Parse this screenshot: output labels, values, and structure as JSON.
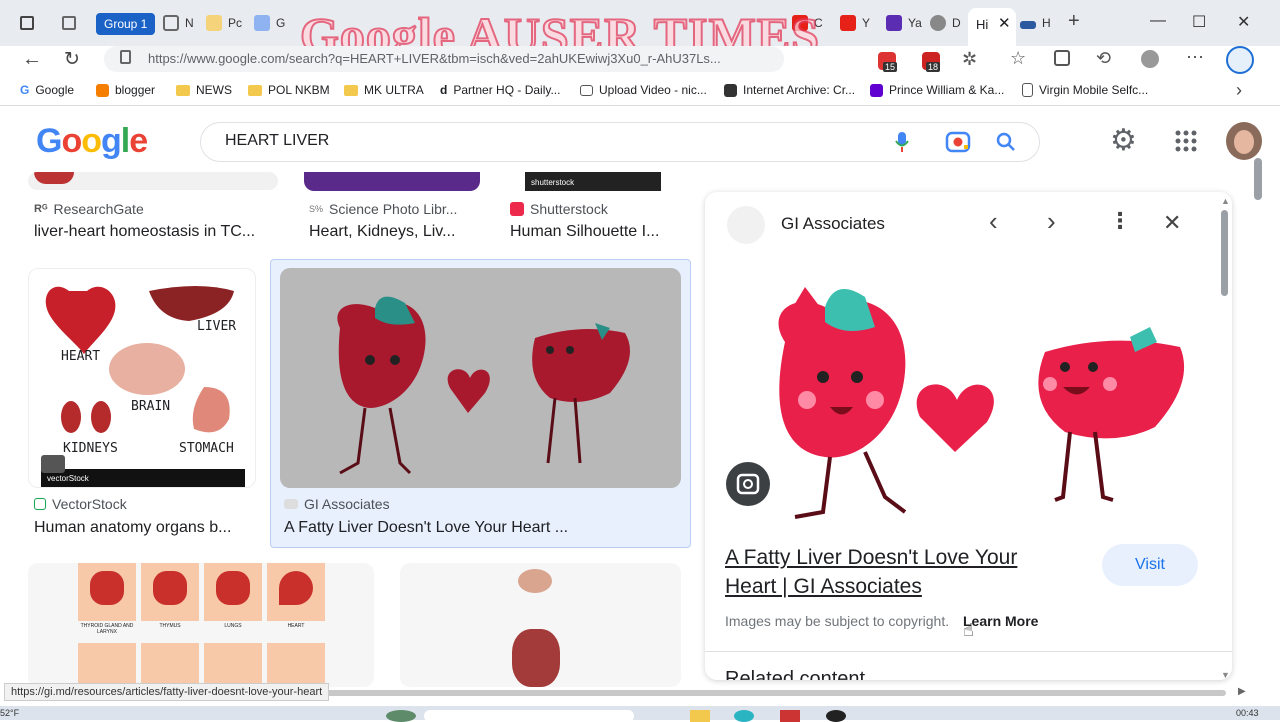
{
  "browser": {
    "group_label": "Group 1",
    "watermark": "Google AUSER TIMES",
    "url": "https://www.google.com/search?q=HEART+LIVER&tbm=isch&ved=2ahUKEwiwj3Xu0_r-AhU37Ls...",
    "tab_badges": [
      "15",
      "18"
    ],
    "bookmarks": [
      {
        "label": "Google",
        "icon": "google-icon"
      },
      {
        "label": "blogger",
        "icon": "blogger-icon"
      },
      {
        "label": "NEWS",
        "icon": "folder-icon"
      },
      {
        "label": "POL NKBM",
        "icon": "folder-icon"
      },
      {
        "label": "MK ULTRA",
        "icon": "folder-icon"
      },
      {
        "label": "Partner HQ - Daily...",
        "icon": "dailymotion-icon"
      },
      {
        "label": "Upload Video - nic...",
        "icon": "upload-icon"
      },
      {
        "label": "Internet Archive: Cr...",
        "icon": "archive-icon"
      },
      {
        "label": "Prince William & Ka...",
        "icon": "yahoo-icon"
      },
      {
        "label": "Virgin Mobile Selfc...",
        "icon": "page-icon"
      }
    ]
  },
  "google": {
    "logo": "Google",
    "query": "HEART LIVER"
  },
  "results": {
    "row1": [
      {
        "source": "ResearchGate",
        "title": "liver-heart homeostasis in TC..."
      },
      {
        "source": "Science Photo Libr...",
        "title": "Heart, Kidneys, Liv..."
      },
      {
        "source": "Shutterstock",
        "title": "Human Silhouette I..."
      }
    ],
    "row2": [
      {
        "source": "VectorStock",
        "title": "Human anatomy organs b...",
        "labels": [
          "HEART",
          "LIVER",
          "BRAIN",
          "KIDNEYS",
          "STOMACH"
        ]
      },
      {
        "source": "GI Associates",
        "title": "A Fatty Liver Doesn't Love Your Heart ..."
      }
    ],
    "row3_labels": [
      "THYROID GLAND AND LARYNX",
      "THYMUS",
      "LUNGS",
      "HEART"
    ],
    "thumb_credit": "shutterstock",
    "vector_credit": "vectorStock"
  },
  "panel": {
    "site": "GI Associates",
    "title_line1": "A Fatty Liver Doesn't Love Your",
    "title_line2": "Heart | GI Associates",
    "visit": "Visit",
    "copyright": "Images may be subject to copyright.",
    "learn_more": "Learn More",
    "related": "Related content"
  },
  "statusbar": {
    "link": "https://gi.md/resources/articles/fatty-liver-doesnt-love-your-heart"
  },
  "taskbar": {
    "temp": "52°F",
    "time": "00:43"
  },
  "colors": {
    "accent": "#1a73e8",
    "heart": "#e8204a",
    "teal": "#3cbfae"
  }
}
